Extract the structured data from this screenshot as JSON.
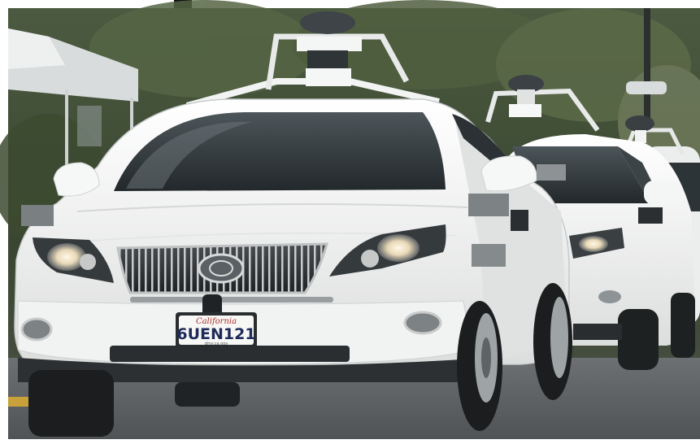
{
  "photo": {
    "plate": {
      "number": "6UEN121",
      "state_script": "California",
      "tagline": "dmv.ca.gov"
    },
    "colors": {
      "foliage": "#3d4a35",
      "car_body": "#f3f4f2",
      "road": "#5c5f61",
      "windshield": "#2c3236"
    }
  }
}
